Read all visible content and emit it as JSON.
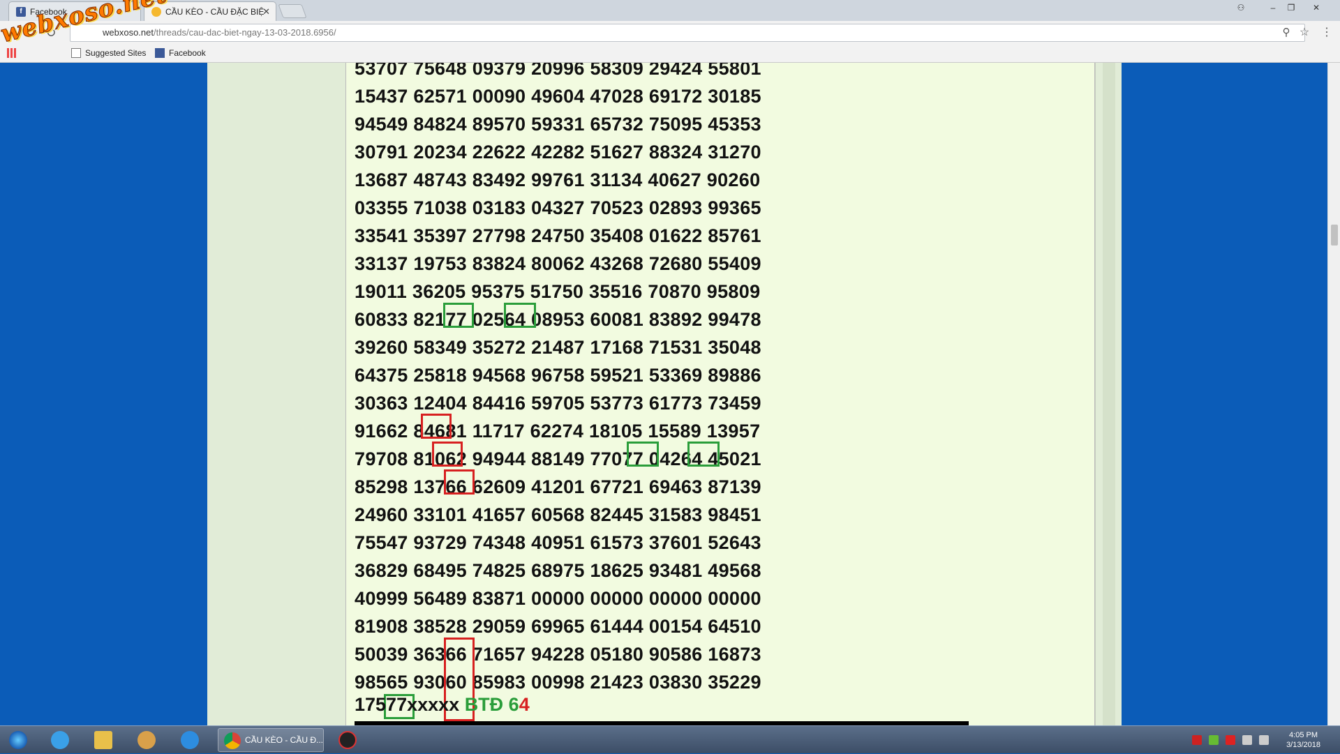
{
  "tabs": [
    {
      "label": "Facebook",
      "icon": "facebook-icon"
    },
    {
      "label": "CẦU KÈO - CẦU ĐẶC BIỆ",
      "icon": "site-favicon-icon",
      "active": true
    }
  ],
  "address": {
    "domain": "webxoso.net",
    "path": "/threads/cau-dac-biet-ngay-13-03-2018.6956/"
  },
  "bookmarks": [
    {
      "label": "Suggested Sites"
    },
    {
      "label": "Facebook"
    }
  ],
  "watermark": "webxoso.net",
  "number_rows": [
    "53707 75648 09379 20996 58309 29424 55801",
    "15437 62571 00090 49604 47028 69172 30185",
    "94549 84824 89570 59331 65732 75095 45353",
    "30791 20234 22622 42282 51627 88324 31270",
    "13687 48743 83492 99761 31134 40627 90260",
    "03355 71038 03183 04327 70523 02893 99365",
    "33541 35397 27798 24750 35408 01622 85761",
    "33137 19753 83824 80062 43268 72680 55409",
    "19011 36205 95375 51750 35516 70870 95809",
    "60833 82177 02564 08953 60081 83892 99478",
    "39260 58349 35272 21487 17168 71531 35048",
    "64375 25818 94568 96758 59521 53369 89886",
    "30363 12404 84416 59705 53773 61773 73459",
    "91662 84681 11717 62274 18105 15589 13957",
    "79708 81062 94944 88149 77077 04264 45021",
    "85298 13766 62609 41201 67721 69463 87139",
    "24960 33101 41657 60568 82445 31583 98451",
    "75547 93729 74348 40951 61573 37601 52643",
    "36829 68495 74825 68975 18625 93481 49568",
    "40999 56489 83871 00000 00000 00000 00000",
    "81908 38528 29059 69965 61444 00154 64510",
    "50039 36366 71657 94228 05180 90586 16873",
    "98565 93060 85983 00998 21423 03830 35229"
  ],
  "last_line": {
    "digits": "17577xxxxx",
    "btd_label": "BTĐ 6",
    "btd_last": "4"
  },
  "taskbar": {
    "chrome_task_label": "CẦU KÈO - CẦU Đ...",
    "time": "4:05 PM",
    "date": "3/13/2018"
  },
  "colors": {
    "page_bg": "#0b5cb8",
    "content_bg": "#f2fbe0",
    "highlight_green": "#2a9d3a",
    "highlight_red": "#d72020"
  }
}
